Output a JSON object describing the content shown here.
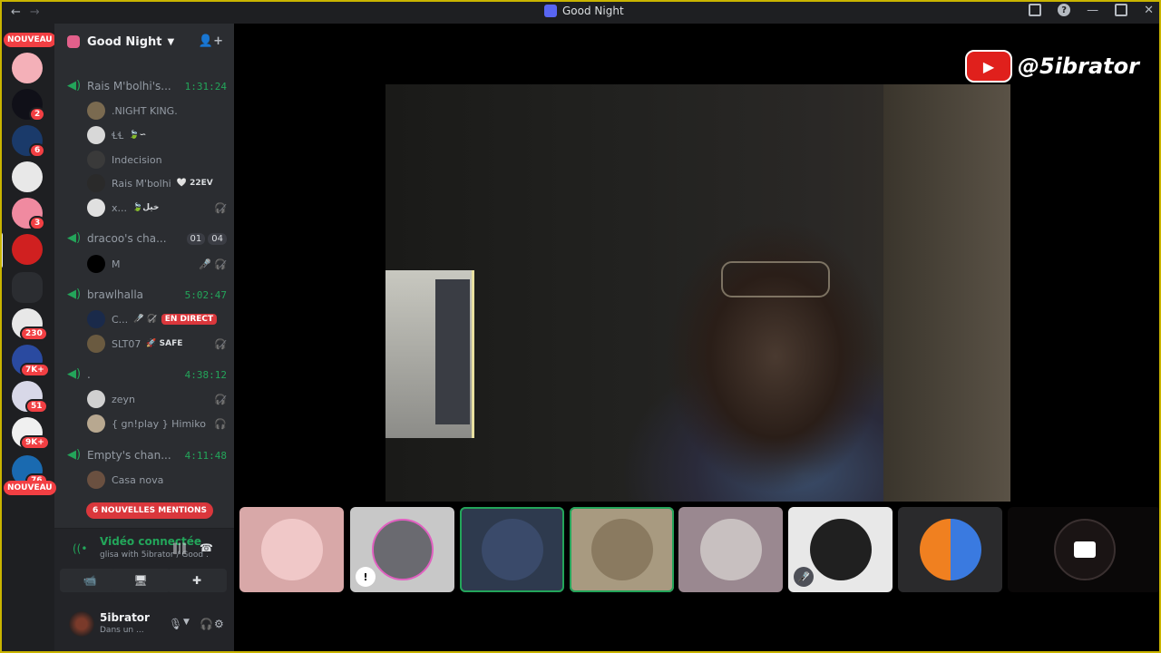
{
  "window": {
    "title": "Good Night",
    "back": "←",
    "forward": "→",
    "minimize": "—",
    "close": "✕",
    "help": "?"
  },
  "rail": {
    "nouveau_top": "NOUVEAU",
    "nouveau_bottom": "NOUVEAU",
    "badges": [
      "2",
      "6",
      "3",
      "230",
      "7K+",
      "51",
      "9K+",
      "76"
    ]
  },
  "server": {
    "name": "Good Night",
    "channels": [
      {
        "name": "Rais M'bolhi's...",
        "time": "1:31:24",
        "members": [
          {
            "name": ".NIGHT KING.",
            "tag": "",
            "icon": ""
          },
          {
            "name": "ꞭꞭ",
            "tag": "🍃∽",
            "icon": ""
          },
          {
            "name": "Indecision",
            "tag": "",
            "icon": ""
          },
          {
            "name": "Rais M'bolhi",
            "tag": "🤍 22EV",
            "icon": ""
          },
          {
            "name": "x...",
            "tag": "🍃خيل",
            "icon": "🎧̸"
          }
        ]
      },
      {
        "name": "dracoo's cha...",
        "time": "",
        "pills": [
          "01",
          "04"
        ],
        "members": [
          {
            "name": "M",
            "tag": "",
            "icon": "🎤̸ 🎧̸"
          }
        ]
      },
      {
        "name": "brawlhalla",
        "time": "5:02:47",
        "members": [
          {
            "name": "C...",
            "tag": "",
            "icon": "🎤̸ 🎧̸",
            "live": "EN DIRECT"
          },
          {
            "name": "SLT07",
            "tag": "🚀 SAFE",
            "icon": "🎧̸"
          }
        ]
      },
      {
        "name": ".",
        "time": "4:38:12",
        "members": [
          {
            "name": "zeyn",
            "tag": "",
            "icon": "🎧̸"
          },
          {
            "name": "{ gn!play } Himiko",
            "tag": "",
            "icon": "🎧"
          }
        ]
      },
      {
        "name": "Empty's chan...",
        "time": "4:11:48",
        "members": [
          {
            "name": "Casa nova",
            "tag": "",
            "icon": ""
          }
        ]
      }
    ],
    "mentions": "6 NOUVELLES MENTIONS"
  },
  "voice": {
    "status": "Vidéo connectée",
    "subtitle": "glisa with 5ibrator / Good ...",
    "buttons": {
      "camera": "📹",
      "screen": "🖥",
      "activity": "✚"
    }
  },
  "user": {
    "name": "5ibrator",
    "status": "Dans un ..."
  },
  "stream": {
    "handle": "@5ibrator",
    "yt_play": "▶"
  },
  "colors": {
    "accent_green": "#23a55a",
    "mention_red": "#da373c",
    "sidebar": "#2b2d31",
    "rail": "#1e1f22"
  }
}
